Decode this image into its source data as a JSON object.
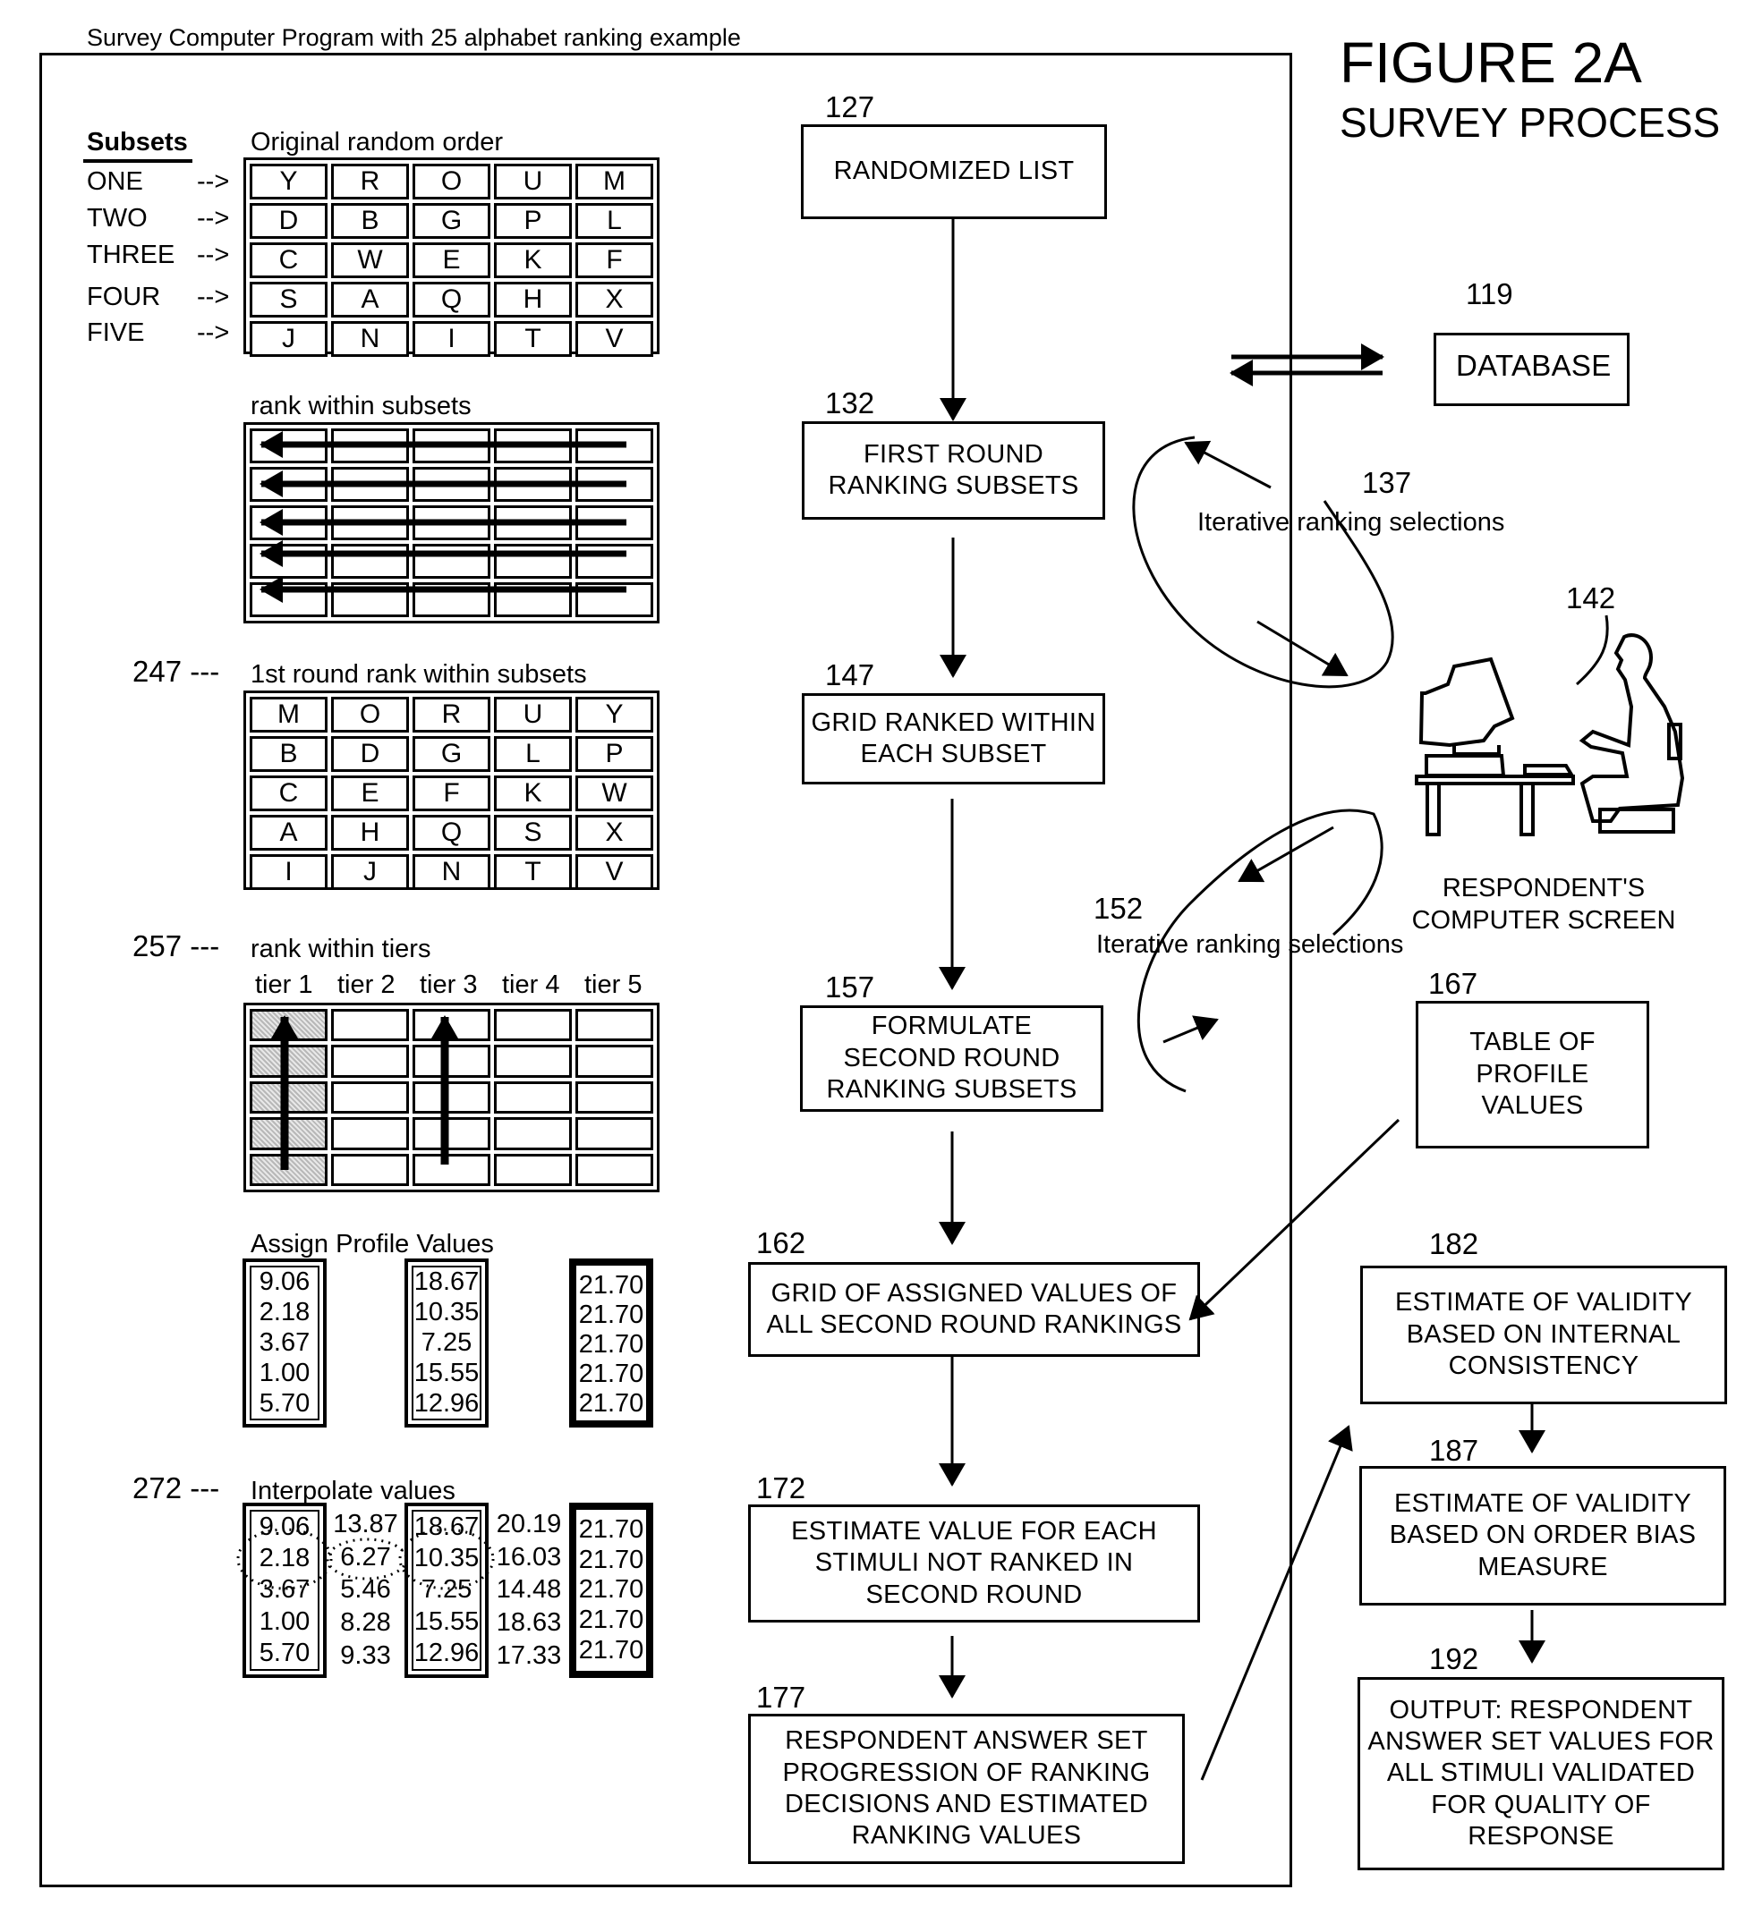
{
  "header": {
    "program_caption": "Survey Computer Program with 25 alphabet ranking example",
    "figure_title": "FIGURE 2A",
    "figure_subtitle": "SURVEY PROCESS"
  },
  "left_panel": {
    "subsets_heading": "Subsets",
    "subset_rows": [
      {
        "label": "ONE",
        "arrow": "-->"
      },
      {
        "label": "TWO",
        "arrow": "-->"
      },
      {
        "label": "THREE",
        "arrow": "-->"
      },
      {
        "label": "FOUR",
        "arrow": "-->"
      },
      {
        "label": "FIVE",
        "arrow": "-->"
      }
    ],
    "original_order": {
      "caption": "Original random order",
      "rows": [
        [
          "Y",
          "R",
          "O",
          "U",
          "M"
        ],
        [
          "D",
          "B",
          "G",
          "P",
          "L"
        ],
        [
          "C",
          "W",
          "E",
          "K",
          "F"
        ],
        [
          "S",
          "A",
          "Q",
          "H",
          "X"
        ],
        [
          "J",
          "N",
          "I",
          "T",
          "V"
        ]
      ]
    },
    "rank_within_subsets": {
      "caption": "rank within subsets",
      "arrow_direction": "left",
      "row_count": 5
    },
    "first_round": {
      "ref": "247 ---",
      "caption": "1st round rank within subsets",
      "rows": [
        [
          "M",
          "O",
          "R",
          "U",
          "Y"
        ],
        [
          "B",
          "D",
          "G",
          "L",
          "P"
        ],
        [
          "C",
          "E",
          "F",
          "K",
          "W"
        ],
        [
          "A",
          "H",
          "Q",
          "S",
          "X"
        ],
        [
          "I",
          "J",
          "N",
          "T",
          "V"
        ]
      ]
    },
    "rank_within_tiers": {
      "ref": "257 ---",
      "caption": "rank within tiers",
      "tiers": [
        "tier 1",
        "tier 2",
        "tier 3",
        "tier 4",
        "tier 5"
      ],
      "shaded_tier": "tier 1",
      "arrow_tiers": [
        "tier 1",
        "tier 3"
      ],
      "arrow_direction": "up"
    },
    "assign_profile_values": {
      "caption": "Assign Profile Values",
      "columns": [
        [
          "9.06",
          "2.18",
          "3.67",
          "1.00",
          "5.70"
        ],
        [
          "18.67",
          "10.35",
          "7.25",
          "15.55",
          "12.96"
        ],
        [
          "21.70",
          "21.70",
          "21.70",
          "21.70",
          "21.70"
        ]
      ]
    },
    "interpolate_values": {
      "ref": "272 ---",
      "caption": "Interpolate values",
      "columns": [
        [
          "9.06",
          "2.18",
          "3.67",
          "1.00",
          "5.70"
        ],
        [
          "13.87",
          "6.27",
          "5.46",
          "8.28",
          "9.33"
        ],
        [
          "18.67",
          "10.35",
          "7.25",
          "15.55",
          "12.96"
        ],
        [
          "20.19",
          "16.03",
          "14.48",
          "18.63",
          "17.33"
        ],
        [
          "21.70",
          "21.70",
          "21.70",
          "21.70",
          "21.70"
        ]
      ],
      "circled_values": [
        "2.18",
        "6.27",
        "10.35"
      ]
    }
  },
  "flow": {
    "nodes": [
      {
        "id": "127",
        "ref": "127",
        "lines": [
          "RANDOMIZED LIST"
        ]
      },
      {
        "id": "132",
        "ref": "132",
        "lines": [
          "FIRST ROUND",
          "RANKING SUBSETS"
        ]
      },
      {
        "id": "147",
        "ref": "147",
        "lines": [
          "GRID RANKED WITHIN",
          "EACH SUBSET"
        ]
      },
      {
        "id": "157",
        "ref": "157",
        "lines": [
          "FORMULATE",
          "SECOND ROUND",
          "RANKING SUBSETS"
        ]
      },
      {
        "id": "162",
        "ref": "162",
        "lines": [
          "GRID OF ASSIGNED VALUES OF",
          "ALL SECOND ROUND RANKINGS"
        ]
      },
      {
        "id": "172",
        "ref": "172",
        "lines": [
          "ESTIMATE VALUE FOR EACH",
          "STIMULI NOT RANKED IN",
          "SECOND ROUND"
        ]
      },
      {
        "id": "177",
        "ref": "177",
        "lines": [
          "RESPONDENT ANSWER SET",
          "PROGRESSION OF RANKING",
          "DECISIONS AND ESTIMATED",
          "RANKING VALUES"
        ]
      },
      {
        "id": "119",
        "ref": "119",
        "lines": [
          "DATABASE"
        ]
      },
      {
        "id": "167",
        "ref": "167",
        "lines": [
          "TABLE OF",
          "PROFILE",
          "VALUES"
        ]
      },
      {
        "id": "182",
        "ref": "182",
        "lines": [
          "ESTIMATE OF VALIDITY",
          "BASED ON INTERNAL",
          "CONSISTENCY"
        ]
      },
      {
        "id": "187",
        "ref": "187",
        "lines": [
          "ESTIMATE OF VALIDITY",
          "BASED ON ORDER BIAS",
          "MEASURE"
        ]
      },
      {
        "id": "192",
        "ref": "192",
        "lines": [
          "OUTPUT: RESPONDENT",
          "ANSWER SET VALUES FOR",
          "ALL STIMULI VALIDATED",
          "FOR QUALITY OF",
          "RESPONSE"
        ]
      }
    ],
    "edges": [
      {
        "from": "127",
        "to": "132"
      },
      {
        "from": "132",
        "to": "147"
      },
      {
        "from": "147",
        "to": "157"
      },
      {
        "from": "157",
        "to": "162"
      },
      {
        "from": "167",
        "to": "162"
      },
      {
        "from": "162",
        "to": "172"
      },
      {
        "from": "172",
        "to": "177"
      },
      {
        "from": "177",
        "to": "182"
      },
      {
        "from": "182",
        "to": "187"
      },
      {
        "from": "187",
        "to": "192"
      },
      {
        "from": "program",
        "to": "119",
        "bidirectional": true
      }
    ],
    "loops": [
      {
        "ref": "137",
        "label": "Iterative ranking selections",
        "between": [
          "132",
          "142"
        ]
      },
      {
        "ref": "152",
        "label": "Iterative ranking selections",
        "between": [
          "157",
          "142"
        ]
      }
    ],
    "respondent": {
      "ref": "142",
      "icon": "person-at-computer-icon",
      "lines": [
        "RESPONDENT'S",
        "COMPUTER SCREEN"
      ]
    }
  }
}
